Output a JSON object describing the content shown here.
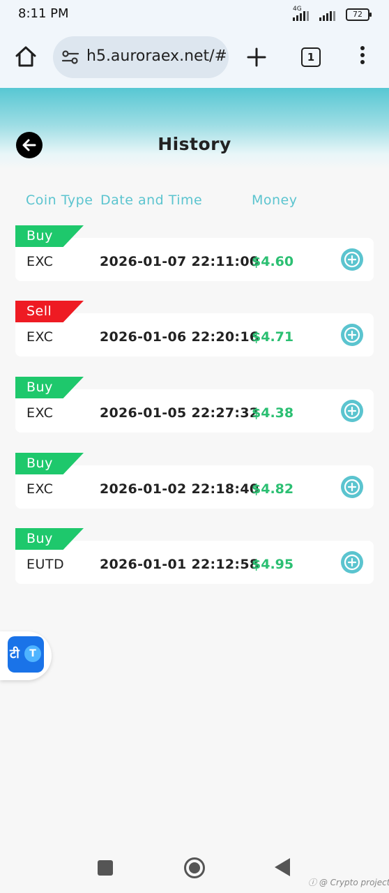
{
  "status_bar": {
    "time": "8:11 PM",
    "network": "4G",
    "battery": "72"
  },
  "browser": {
    "url": "h5.auroraex.net/#",
    "tab_count": "1",
    "icons": {
      "home": "home-icon",
      "site_settings": "site-settings-icon",
      "new_tab": "plus-icon",
      "menu": "more-vertical-icon"
    }
  },
  "page": {
    "title": "History",
    "back_icon": "arrow-left-icon"
  },
  "columns": {
    "coin_type": "Coin Type",
    "date_time": "Date and Time",
    "money": "Money"
  },
  "records": [
    {
      "type": "Buy",
      "coin": "EXC",
      "datetime": "2026-01-07 22:11:00",
      "money": "$4.60"
    },
    {
      "type": "Sell",
      "coin": "EXC",
      "datetime": "2026-01-06 22:20:16",
      "money": "$4.71"
    },
    {
      "type": "Buy",
      "coin": "EXC",
      "datetime": "2026-01-05 22:27:32",
      "money": "$4.38"
    },
    {
      "type": "Buy",
      "coin": "EXC",
      "datetime": "2026-01-02 22:18:40",
      "money": "$4.82"
    },
    {
      "type": "Buy",
      "coin": "EUTD",
      "datetime": "2026-01-01 22:12:58",
      "money": "$4.95"
    }
  ],
  "translate_widget": {
    "left_glyph": "टी",
    "right_glyph": "T"
  },
  "watermark": "ⓘ @ Crypto project",
  "colors": {
    "accent": "#5bc4cf",
    "buy": "#1ec86c",
    "sell": "#ee1b23",
    "money": "#2bbf72"
  }
}
